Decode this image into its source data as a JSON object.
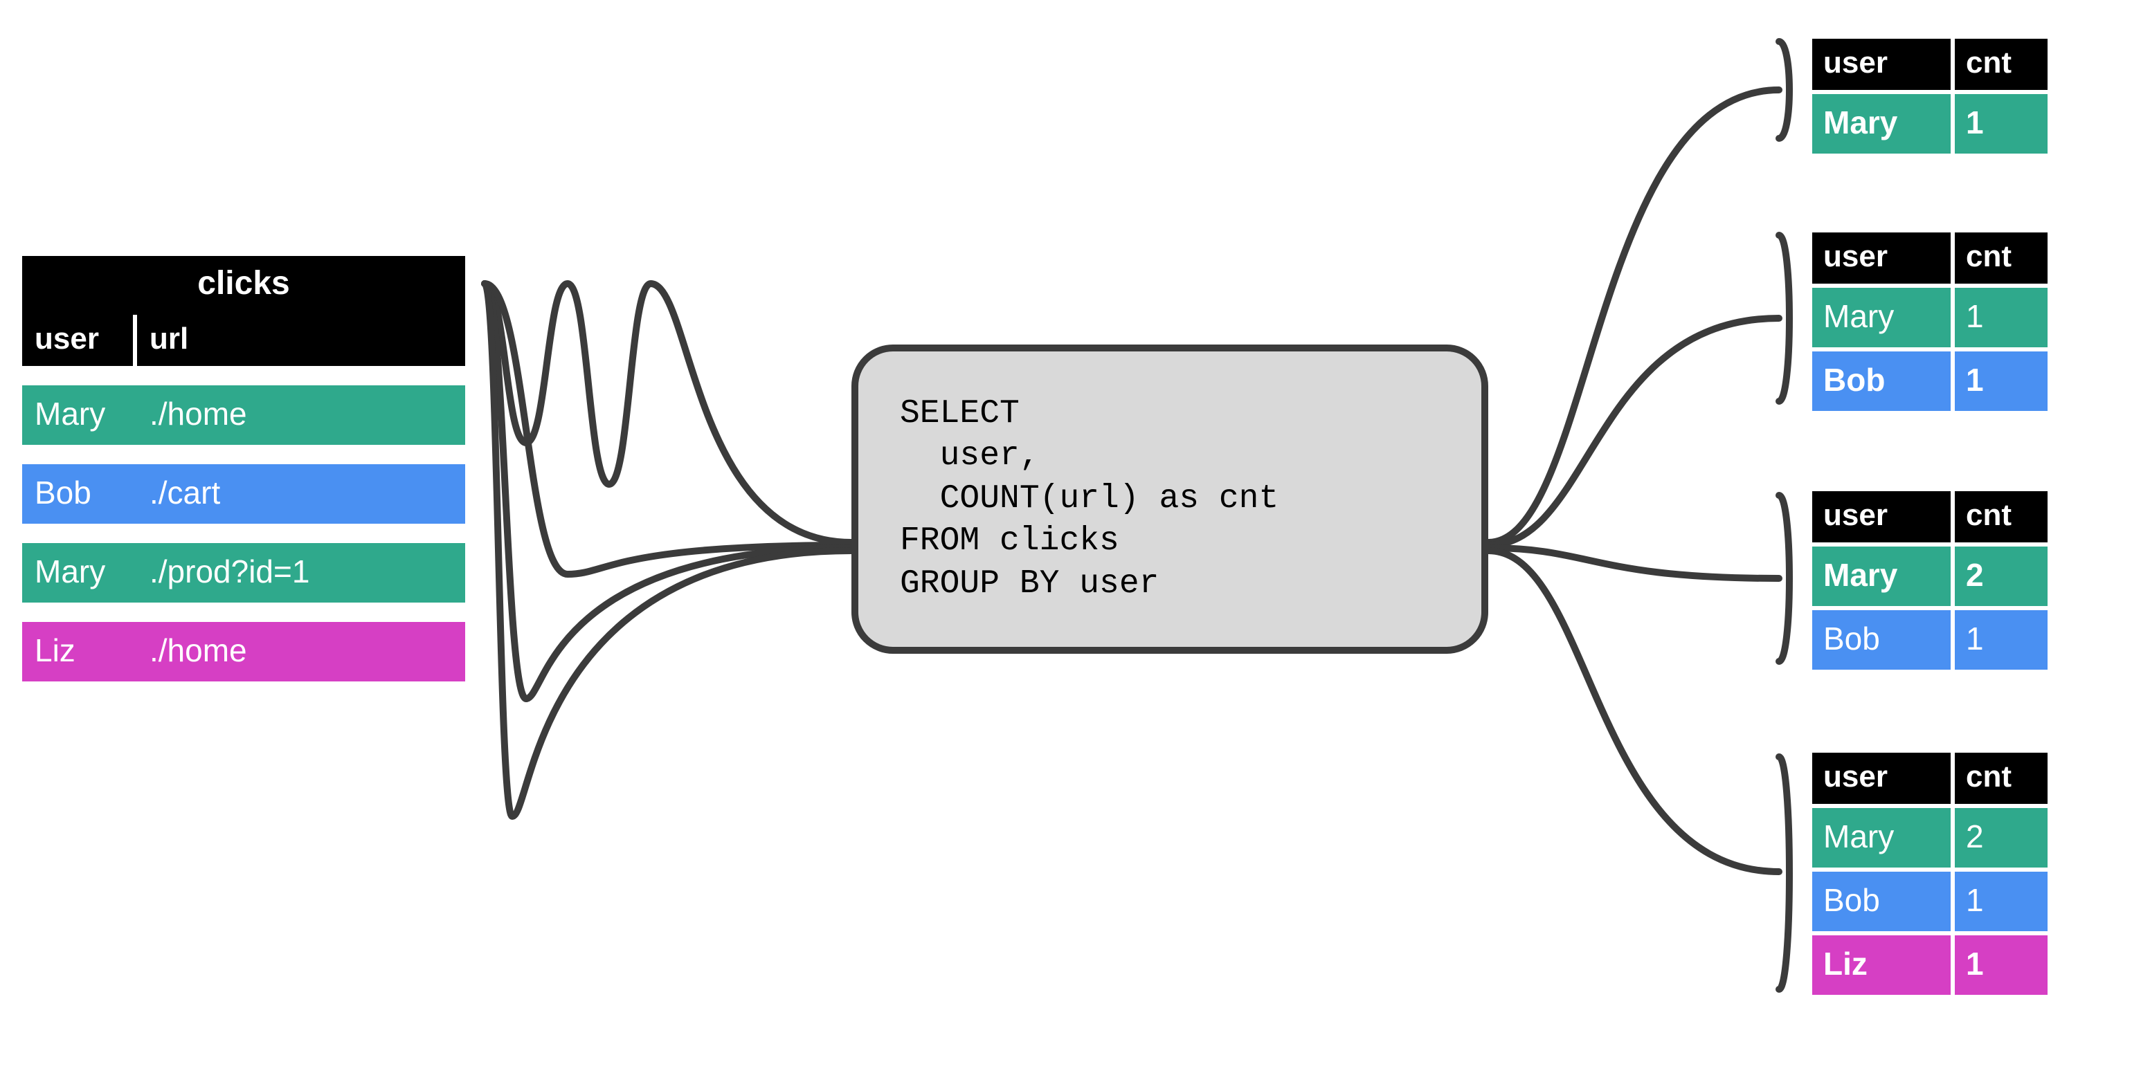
{
  "colors": {
    "teal": "#2fa98c",
    "blue": "#4a90f2",
    "pink": "#d63fc4",
    "black": "#000000",
    "box_fill": "#d9d9d9",
    "box_border": "#3b3b3b"
  },
  "input_table": {
    "title": "clicks",
    "columns": [
      "user",
      "url"
    ],
    "rows": [
      {
        "user": "Mary",
        "url": "./home",
        "color": "teal"
      },
      {
        "user": "Bob",
        "url": "./cart",
        "color": "blue"
      },
      {
        "user": "Mary",
        "url": "./prod?id=1",
        "color": "teal"
      },
      {
        "user": "Liz",
        "url": "./home",
        "color": "pink"
      }
    ]
  },
  "sql": {
    "lines": [
      "SELECT",
      "  user,",
      "  COUNT(url) as cnt",
      "FROM clicks",
      "GROUP BY user"
    ]
  },
  "output_tables": {
    "columns": [
      "user",
      "cnt"
    ],
    "snapshots": [
      {
        "rows": [
          {
            "user": "Mary",
            "cnt": "1",
            "color": "teal",
            "bold": true
          }
        ]
      },
      {
        "rows": [
          {
            "user": "Mary",
            "cnt": "1",
            "color": "teal",
            "bold": false
          },
          {
            "user": "Bob",
            "cnt": "1",
            "color": "blue",
            "bold": true
          }
        ]
      },
      {
        "rows": [
          {
            "user": "Mary",
            "cnt": "2",
            "color": "teal",
            "bold": true
          },
          {
            "user": "Bob",
            "cnt": "1",
            "color": "blue",
            "bold": false
          }
        ]
      },
      {
        "rows": [
          {
            "user": "Mary",
            "cnt": "2",
            "color": "teal",
            "bold": false
          },
          {
            "user": "Bob",
            "cnt": "1",
            "color": "blue",
            "bold": false
          },
          {
            "user": "Liz",
            "cnt": "1",
            "color": "pink",
            "bold": true
          }
        ]
      }
    ]
  }
}
